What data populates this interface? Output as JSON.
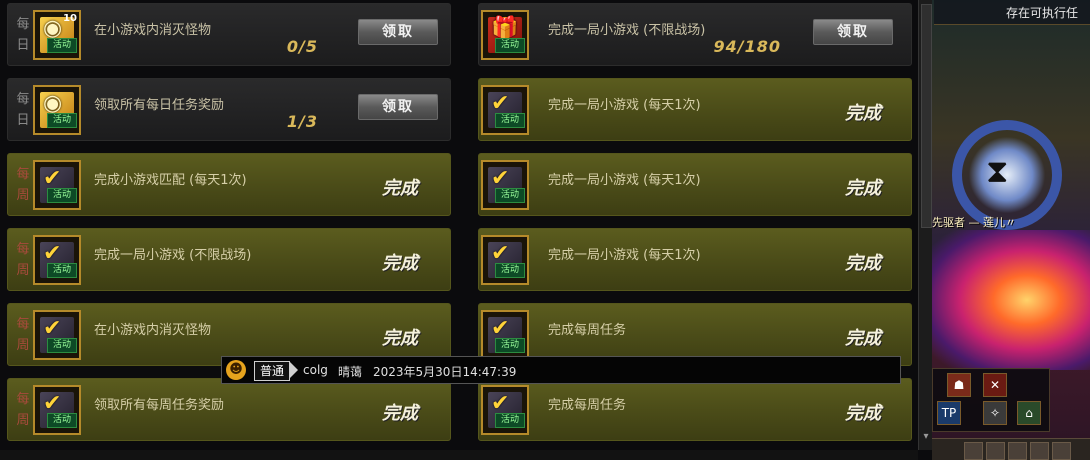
{
  "left_tasks": [
    {
      "freq": "每日",
      "title": "在小游戏内消灭怪物",
      "status": "pending",
      "progress": "0/5",
      "button": "领取",
      "icon": "gold-activity-icon",
      "icon_num": "10",
      "badge": "活动"
    },
    {
      "freq": "每日",
      "title": "领取所有每日任务奖励",
      "status": "pending",
      "progress": "1/3",
      "button": "领取",
      "icon": "gold-activity-icon",
      "icon_num": "",
      "badge": "活动"
    },
    {
      "freq": "每周",
      "title": "完成小游戏匹配 (每天1次)",
      "status": "done",
      "done_label": "完成",
      "icon": "checkmark-activity-icon",
      "icon_num": "",
      "badge": "活动"
    },
    {
      "freq": "每周",
      "title": "完成一局小游戏 (不限战场)",
      "status": "done",
      "done_label": "完成",
      "icon": "checkmark-activity-icon",
      "icon_num": "",
      "badge": "活动"
    },
    {
      "freq": "每周",
      "title": "在小游戏内消灭怪物",
      "status": "done",
      "done_label": "完成",
      "icon": "checkmark-activity-icon",
      "icon_num": "",
      "badge": "活动"
    },
    {
      "freq": "每周",
      "title": "领取所有每周任务奖励",
      "status": "done",
      "done_label": "完成",
      "icon": "checkmark-activity-icon",
      "icon_num": "",
      "badge": "活动"
    }
  ],
  "right_tasks": [
    {
      "title": "完成一局小游戏 (不限战场)",
      "status": "pending",
      "progress": "94/180",
      "button": "领取",
      "icon": "gift-activity-icon"
    },
    {
      "title": "完成一局小游戏 (每天1次)",
      "status": "done",
      "done_label": "完成",
      "icon": "checkmark-activity-icon"
    },
    {
      "title": "完成一局小游戏 (每天1次)",
      "status": "done",
      "done_label": "完成",
      "icon": "checkmark-activity-icon"
    },
    {
      "title": "完成一局小游戏 (每天1次)",
      "status": "done",
      "done_label": "完成",
      "icon": "checkmark-activity-icon"
    },
    {
      "title": "完成每周任务",
      "status": "done",
      "done_label": "完成",
      "icon": "checkmark-activity-icon"
    },
    {
      "title": "完成每周任务",
      "status": "done",
      "done_label": "完成",
      "icon": "checkmark-activity-icon"
    }
  ],
  "game": {
    "notice": "存在可执行任",
    "player_name": "先驱者 — 莲儿〃"
  },
  "chat": {
    "channel": "普通",
    "user": "colg",
    "message": "晴蔼",
    "time": "2023年5月30日14:47:39"
  },
  "colors": {
    "done_bg": "#4a4b18",
    "pending_bg": "#1c1c1d",
    "progress": "#d9b85a",
    "weekly_label": "#a94a3c"
  }
}
